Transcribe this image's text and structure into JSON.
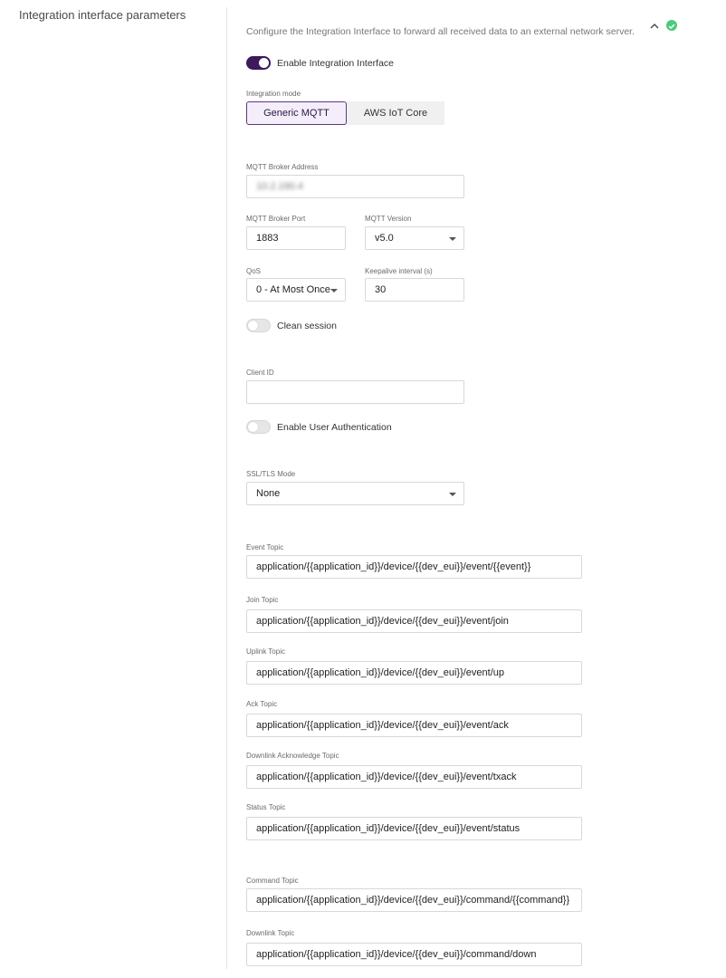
{
  "section": {
    "title": "Integration interface parameters",
    "description": "Configure the Integration Interface to forward all received data to an external network server."
  },
  "enable_integration": {
    "label": "Enable Integration Interface",
    "on": true
  },
  "integration_mode": {
    "label": "Integration mode",
    "options": [
      "Generic MQTT",
      "AWS IoT Core"
    ],
    "selected": "Generic MQTT"
  },
  "broker_address": {
    "label": "MQTT Broker Address",
    "value": "10.2.190.4"
  },
  "broker_port": {
    "label": "MQTT Broker Port",
    "value": "1883"
  },
  "mqtt_version": {
    "label": "MQTT Version",
    "value": "v5.0"
  },
  "qos": {
    "label": "QoS",
    "value": "0 - At Most Once"
  },
  "keepalive": {
    "label": "Keepalive interval (s)",
    "value": "30"
  },
  "clean_session": {
    "label": "Clean session",
    "on": false
  },
  "client_id": {
    "label": "Client ID",
    "value": ""
  },
  "user_auth": {
    "label": "Enable User Authentication",
    "on": false
  },
  "ssl_mode": {
    "label": "SSL/TLS Mode",
    "value": "None"
  },
  "topics": [
    {
      "label": "Event Topic",
      "value": "application/{{application_id}}/device/{{dev_eui}}/event/{{event}}"
    },
    {
      "label": "Join Topic",
      "value": "application/{{application_id}}/device/{{dev_eui}}/event/join"
    },
    {
      "label": "Uplink Topic",
      "value": "application/{{application_id}}/device/{{dev_eui}}/event/up"
    },
    {
      "label": "Ack Topic",
      "value": "application/{{application_id}}/device/{{dev_eui}}/event/ack"
    },
    {
      "label": "Downlink Acknowledge Topic",
      "value": "application/{{application_id}}/device/{{dev_eui}}/event/txack"
    },
    {
      "label": "Status Topic",
      "value": "application/{{application_id}}/device/{{dev_eui}}/event/status"
    },
    {
      "label": "Command Topic",
      "value": "application/{{application_id}}/device/{{dev_eui}}/command/{{command}}"
    },
    {
      "label": "Downlink Topic",
      "value": "application/{{application_id}}/device/{{dev_eui}}/command/down"
    }
  ],
  "icons": {
    "collapse": "chevron-up-icon",
    "status": "check-circle-icon"
  },
  "colors": {
    "accent": "#3c1a5b",
    "success": "#4ccb7a"
  }
}
